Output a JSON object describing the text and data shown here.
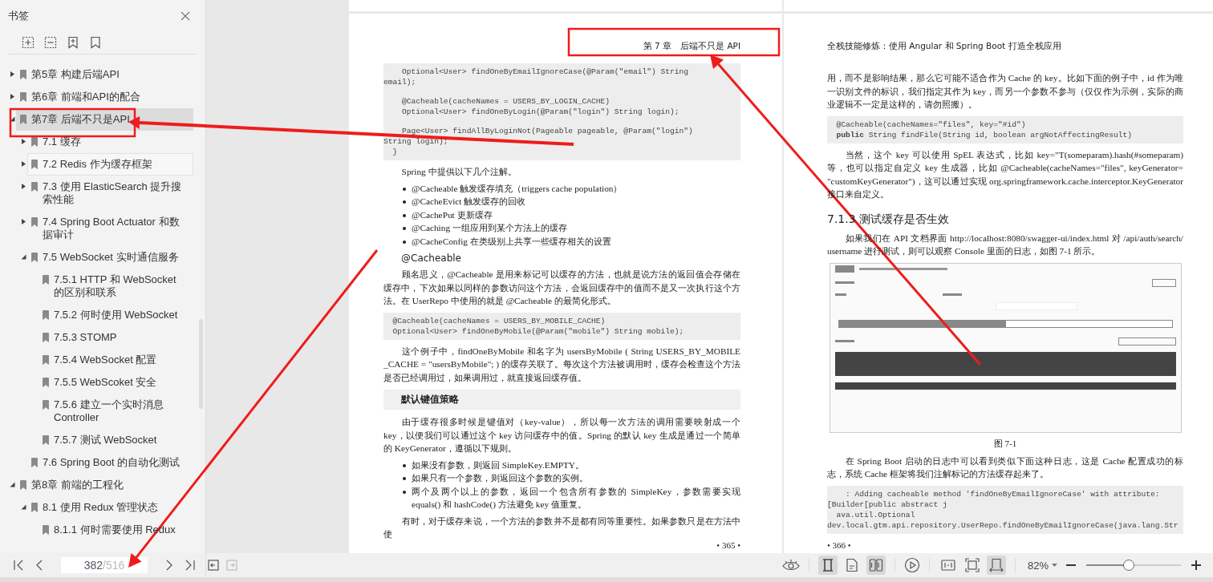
{
  "sidebar": {
    "title": "书签",
    "items": [
      {
        "label": "第5章 构建后端API",
        "expanded": false,
        "selected": false
      },
      {
        "label": "第6章 前端和API的配合",
        "expanded": false,
        "selected": false
      },
      {
        "label": "第7章 后端不只是API",
        "expanded": true,
        "selected": true,
        "children": [
          {
            "label": "7.1 缓存",
            "expanded": false,
            "selected": false
          },
          {
            "label": "7.2 Redis 作为缓存框架",
            "expanded": false,
            "selected": false,
            "hovered": true
          },
          {
            "label": "7.3 使用 ElasticSearch 提升搜索性能",
            "expanded": false,
            "selected": false
          },
          {
            "label": "7.4 Spring Boot Actuator 和数据审计",
            "expanded": false,
            "selected": false
          },
          {
            "label": "7.5 WebSocket 实时通信服务",
            "expanded": true,
            "selected": false,
            "children": [
              {
                "label": "7.5.1 HTTP 和 WebSocket 的区别和联系",
                "selected": false
              },
              {
                "label": "7.5.2 何时使用 WebSocket",
                "selected": false
              },
              {
                "label": "7.5.3 STOMP",
                "selected": false
              },
              {
                "label": "7.5.4 WebSocket 配置",
                "selected": false
              },
              {
                "label": "7.5.5 WebScoket 安全",
                "selected": false
              },
              {
                "label": "7.5.6 建立一个实时消息 Controller",
                "selected": false
              },
              {
                "label": "7.5.7 测试 WebSocket",
                "selected": false
              }
            ]
          },
          {
            "label": "7.6 Spring Boot 的自动化测试",
            "selected": false
          }
        ]
      },
      {
        "label": "第8章 前端的工程化",
        "expanded": true,
        "selected": false,
        "children": [
          {
            "label": "8.1 使用 Redux 管理状态",
            "expanded": true,
            "selected": false,
            "children": [
              {
                "label": "8.1.1 何时需要使用 Redux",
                "selected": false
              }
            ]
          }
        ]
      }
    ],
    "nav": {
      "page": "382",
      "total": "/516"
    }
  },
  "pages": [
    {
      "header": "第 7 章　后端不只是 API",
      "blocks": [
        {
          "kind": "code",
          "groups": [
            [
              "    Optional<User> findOneByEmailIgnoreCase(@Param(\"email\") String",
              "email);"
            ],
            [
              "    @Cacheable(cacheNames = USERS_BY_LOGIN_CACHE)",
              "    Optional<User> findOneByLogin(@Param(\"login\") String login);"
            ],
            [
              "    Page<User> findAllByLoginNot(Pageable pageable, @Param(\"login\")",
              "String login);",
              "  }"
            ]
          ]
        },
        {
          "kind": "para",
          "indent": true,
          "text": "Spring 中提供以下几个注解。"
        },
        {
          "kind": "bullets",
          "items": [
            "@Cacheable 触发缓存填充（triggers cache population）",
            "@CacheEvict 触发缓存的回收",
            "@CachePut 更新缓存",
            "@Caching 一组应用到某个方法上的缓存",
            "@CacheConfig 在类级别上共享一些缓存相关的设置"
          ]
        },
        {
          "kind": "heading",
          "text": "@Cacheable"
        },
        {
          "kind": "para",
          "indent": true,
          "text": "顾名思义，@Cacheable 是用来标记可以缓存的方法，也就是说方法的返回值会存储在缓存中，下次如果以同样的参数访问这个方法，会返回缓存中的值而不是又一次执行这个方法。在 UserRepo 中使用的就是 @Cacheable 的最简化形式。"
        },
        {
          "kind": "code",
          "groups": [
            [
              "  @Cacheable(cacheNames = USERS_BY_MOBILE_CACHE)",
              "  Optional<User> findOneByMobile(@Param(\"mobile\") String mobile);"
            ]
          ]
        },
        {
          "kind": "para",
          "indent": true,
          "text": "这个例子中，findOneByMobile 和名字为 usersByMobile ( String USERS_BY_MOBILE _CACHE = \"usersByMobile\"; ) 的缓存关联了。每次这个方法被调用时，缓存会检查这个方法是否已经调用过，如果调用过，就直接返回缓存值。"
        },
        {
          "kind": "boxheading",
          "text": "默认键值策略"
        },
        {
          "kind": "para",
          "indent": true,
          "text": "由于缓存很多时候是键值对（key-value），所以每一次方法的调用需要映射成一个 key，以便我们可以通过这个 key 访问缓存中的值。Spring 的默认 key 生成是通过一个简单的 KeyGenerator，遵循以下规则。"
        },
        {
          "kind": "bullets",
          "items": [
            "如果没有参数，则返回 SimpleKey.EMPTY。",
            "如果只有一个参数，则返回这个参数的实例。",
            "两个及两个以上的参数，返回一个包含所有参数的 SimpleKey，参数需要实现 equals() 和 hashCode() 方法避免 key 值重复。"
          ]
        },
        {
          "kind": "para",
          "indent": true,
          "text": "有时，对于缓存来说，一个方法的参数并不是都有同等重要性。如果参数只是在方法中使"
        }
      ],
      "page_number": "• 365 •"
    },
    {
      "header": "全栈技能修炼：使用 Angular 和 Spring Boot 打造全栈应用",
      "blocks": [
        {
          "kind": "para",
          "indent": false,
          "text": "用，而不是影响结果，那么它可能不适合作为 Cache 的 key。比如下面的例子中，id 作为唯一识别文件的标识，我们指定其作为 key，而另一个参数不参与（仅仅作为示例，实际的商业逻辑不一定是这样的，请勿照搬）。"
        },
        {
          "kind": "code",
          "groups": [
            [
              "  @Cacheable(cacheNames=\"files\", key=\"#id\")",
              "  **public** String findFile(String id, boolean argNotAffectingResult)"
            ]
          ]
        },
        {
          "kind": "para",
          "indent": true,
          "text": "当然，这个 key 可以使用 SpEL 表达式，比如 key=\"T(someparam).hash(#someparam) 等，也可以指定自定义 key 生成器，比如 @Cacheable(cacheNames=\"files\", keyGenerator= \"customKeyGenerator\")，这可以通过实现 org.springframework.cache.interceptor.KeyGenerator 接口来自定义。"
        },
        {
          "kind": "section",
          "text": "7.1.3 测试缓存是否生效"
        },
        {
          "kind": "para",
          "indent": true,
          "text": "如果我们在 API 文档界面 http://localhost:8080/swagger-ui/index.html 对 /api/auth/search/ username 进行测试，则可以观察 Console 里面的日志，如图 7-1 所示。"
        },
        {
          "kind": "figure"
        },
        {
          "kind": "caption",
          "text": "图 7-1"
        },
        {
          "kind": "para",
          "indent": true,
          "text": "在 Spring Boot 启动的日志中可以看到类似下面这种日志，这是 Cache 配置成功的标志，系统 Cache 框架将我们注解标记的方法缓存起来了。"
        },
        {
          "kind": "code",
          "groups": [
            [
              "    : Adding cacheable method 'findOneByEmailIgnoreCase' with attribute:",
              "[Builder[public abstract j",
              "  ava.util.Optional",
              "dev.local.gtm.api.repository.UserRepo.findOneByEmailIgnoreCase(java.lang.Str"
            ]
          ]
        }
      ],
      "page_number": "• 366 •"
    }
  ],
  "toolbar": {
    "view_modes": [
      {
        "kind": "continuous",
        "selected": true
      },
      {
        "kind": "single",
        "selected": false
      },
      {
        "kind": "double",
        "selected": true
      }
    ],
    "fit_modes": [
      {
        "kind": "actual",
        "selected": false
      },
      {
        "kind": "page",
        "selected": false
      },
      {
        "kind": "width",
        "selected": true
      }
    ],
    "zoom": "82%",
    "zoom_slider": {
      "level": 0.45
    }
  }
}
